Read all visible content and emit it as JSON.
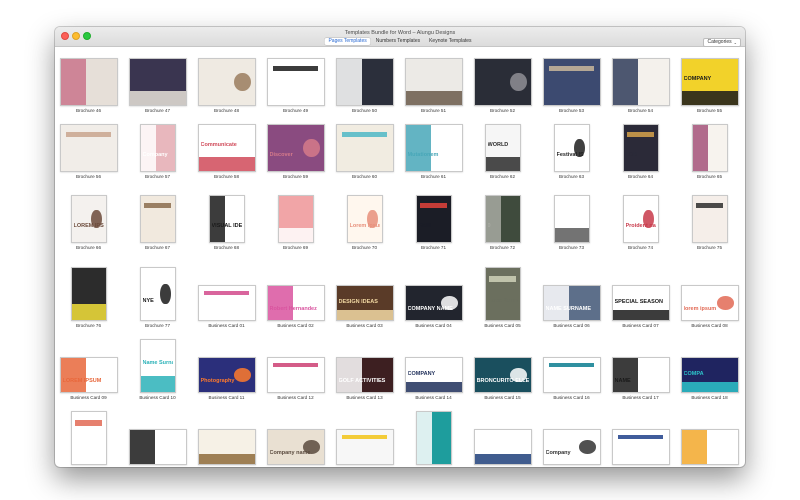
{
  "window": {
    "title": "Templates Bundle for Word – Alungu Designs",
    "tabs": [
      {
        "label": "Pages Templates",
        "active": true
      },
      {
        "label": "Numbers Templates",
        "active": false
      },
      {
        "label": "Keynote Templates",
        "active": false
      }
    ],
    "categories_label": "Categories"
  },
  "rows": [
    [
      {
        "label": "Brochure 46",
        "color": "#e6dfd8",
        "accent": "#c9758c",
        "text": ""
      },
      {
        "label": "Brochure 47",
        "color": "#3a3550",
        "accent": "#e8e2d8",
        "text": ""
      },
      {
        "label": "Brochure 48",
        "color": "#efeae2",
        "accent": "#9a7c5e",
        "text": ""
      },
      {
        "label": "Brochure 49",
        "color": "#ffffff",
        "accent": "#1a1a1a",
        "text": "LOR IPSU DO"
      },
      {
        "label": "Brochure 50",
        "color": "#2b2f3b",
        "accent": "#ffffff",
        "text": ""
      },
      {
        "label": "Brochure 51",
        "color": "#eceae6",
        "accent": "#6b5b4a",
        "text": ""
      },
      {
        "label": "Brochure 52",
        "color": "#2a2d37",
        "accent": "#8f8f95",
        "text": ""
      },
      {
        "label": "Brochure 53",
        "color": "#3c4a70",
        "accent": "#c9b79b",
        "text": ""
      },
      {
        "label": "Brochure 54",
        "color": "#f4f1ec",
        "accent": "#2f3c5a",
        "text": ""
      },
      {
        "label": "Brochure 55",
        "color": "#f2d22a",
        "accent": "#1a1a1a",
        "text": "COMPANY"
      }
    ],
    [
      {
        "label": "Brochure 56",
        "color": "#f1ede8",
        "accent": "#c9a58e",
        "text": ""
      },
      {
        "label": "Brochure 57",
        "color": "#e8b7bd",
        "accent": "#ffffff",
        "text": "Company"
      },
      {
        "label": "Brochure 58",
        "color": "#ffffff",
        "accent": "#d04a59",
        "text": "Communicate"
      },
      {
        "label": "Brochure 59",
        "color": "#8a4b80",
        "accent": "#d57a8a",
        "text": "Discover"
      },
      {
        "label": "Brochure 60",
        "color": "#f1ece1",
        "accent": "#4fb8c6",
        "text": ""
      },
      {
        "label": "Brochure 61",
        "color": "#ffffff",
        "accent": "#48a7b8",
        "text": "Mutationem"
      },
      {
        "label": "Brochure 62",
        "color": "#f6f6f6",
        "accent": "#2c2c2c",
        "text": "WORLD"
      },
      {
        "label": "Brochure 63",
        "color": "#ffffff",
        "accent": "#1f1f1f",
        "text": "Festival IS"
      },
      {
        "label": "Brochure 64",
        "color": "#2b2a38",
        "accent": "#d6a24b",
        "text": "LORI"
      },
      {
        "label": "Brochure 65",
        "color": "#f7f3ee",
        "accent": "#a4527a",
        "text": ""
      }
    ],
    [
      {
        "label": "Brochure 66",
        "color": "#f4f1ee",
        "accent": "#6b4a3a",
        "text": "LOREM IPSUM"
      },
      {
        "label": "Brochure 67",
        "color": "#f1e9de",
        "accent": "#8b6c4e",
        "text": ""
      },
      {
        "label": "Brochure 68",
        "color": "#ffffff",
        "accent": "#1a1a1a",
        "text": "VISUAL IDENTITY"
      },
      {
        "label": "Brochure 69",
        "color": "#f1a5a7",
        "accent": "#ffffff",
        "text": ""
      },
      {
        "label": "Brochure 70",
        "color": "#fff7ee",
        "accent": "#e78f7a",
        "text": "Lorem Ipsum"
      },
      {
        "label": "Brochure 71",
        "color": "#1b1d26",
        "accent": "#e2423b",
        "text": "FAIR"
      },
      {
        "label": "Brochure 72",
        "color": "#3f4b3d",
        "accent": "#a8aaa2",
        "text": "0"
      },
      {
        "label": "Brochure 73",
        "color": "#ffffff",
        "accent": "#5b5b5b",
        "text": ""
      },
      {
        "label": "Brochure 74",
        "color": "#ffffff",
        "accent": "#c8394a",
        "text": "Proident nam"
      },
      {
        "label": "Brochure 75",
        "color": "#f5eee9",
        "accent": "#2d2d2d",
        "text": "01"
      }
    ],
    [
      {
        "label": "Brochure 76",
        "color": "#2c2c2c",
        "accent": "#f3e03a",
        "text": ""
      },
      {
        "label": "Brochure 77",
        "color": "#ffffff",
        "accent": "#1a1a1a",
        "text": "NYE"
      },
      {
        "label": "Business Card 01",
        "color": "#ffffff",
        "accent": "#d24a8c",
        "text": "Name Last Name"
      },
      {
        "label": "Business Card 02",
        "color": "#ffffff",
        "accent": "#d9539f",
        "text": "Robert Hernandez"
      },
      {
        "label": "Business Card 03",
        "color": "#5a3b28",
        "accent": "#f2d9a3",
        "text": "DESIGN IDEAS"
      },
      {
        "label": "Business Card 04",
        "color": "#22252e",
        "accent": "#ffffff",
        "text": "COMPANY NAME"
      },
      {
        "label": "Business Card 05",
        "color": "#6b6f5e",
        "accent": "#cfd2b8",
        "text": "Name Surname"
      },
      {
        "label": "Business Card 06",
        "color": "#5d6f8a",
        "accent": "#ffffff",
        "text": "NAME SURNAME"
      },
      {
        "label": "Business Card 07",
        "color": "#ffffff",
        "accent": "#1a1a1a",
        "text": "SPECIAL SEASON"
      },
      {
        "label": "Business Card 08",
        "color": "#ffffff",
        "accent": "#e26a55",
        "text": "lorem ipsum"
      }
    ],
    [
      {
        "label": "Business Card 09",
        "color": "#ffffff",
        "accent": "#e8673b",
        "text": "LOREM IPSUM"
      },
      {
        "label": "Business Card 10",
        "color": "#ffffff",
        "accent": "#2cb2b8",
        "text": "Name Surname"
      },
      {
        "label": "Business Card 11",
        "color": "#2b2f7b",
        "accent": "#ff7a2c",
        "text": "Photography"
      },
      {
        "label": "Business Card 12",
        "color": "#ffffff",
        "accent": "#cc3f73",
        "text": "LOREM IPSUM"
      },
      {
        "label": "Business Card 13",
        "color": "#3d1f21",
        "accent": "#ffffff",
        "text": "GOLF ACTIVITIES"
      },
      {
        "label": "Business Card 14",
        "color": "#ffffff",
        "accent": "#1f2f5a",
        "text": "COMPANY"
      },
      {
        "label": "Business Card 15",
        "color": "#1a4f5e",
        "accent": "#ffffff",
        "text": "BRONCURITO ELLE"
      },
      {
        "label": "Business Card 16",
        "color": "#ffffff",
        "accent": "#0a7c8f",
        "text": "name"
      },
      {
        "label": "Business Card 17",
        "color": "#ffffff",
        "accent": "#1a1a1a",
        "text": "NAME"
      },
      {
        "label": "Business Card 18",
        "color": "#1f2460",
        "accent": "#2dc3c9",
        "text": "COMPA"
      }
    ],
    [
      {
        "label": "",
        "color": "#ffffff",
        "accent": "#e26a55",
        "text": "Co"
      },
      {
        "label": "",
        "color": "#ffffff",
        "accent": "#1a1a1a",
        "text": ""
      },
      {
        "label": "",
        "color": "#f6f1e6",
        "accent": "#8e6b3a",
        "text": ""
      },
      {
        "label": "",
        "color": "#e9e0d2",
        "accent": "#5a4a3e",
        "text": "Company name"
      },
      {
        "label": "",
        "color": "#f7f7f7",
        "accent": "#f2c417",
        "text": "company"
      },
      {
        "label": "",
        "color": "#1e9d9d",
        "accent": "#ffffff",
        "text": ""
      },
      {
        "label": "",
        "color": "#ffffff",
        "accent": "#1f3f7a",
        "text": ""
      },
      {
        "label": "",
        "color": "#ffffff",
        "accent": "#333333",
        "text": "Company"
      },
      {
        "label": "",
        "color": "#ffffff",
        "accent": "#1f3f8a",
        "text": "COMPANY"
      },
      {
        "label": "",
        "color": "#ffffff",
        "accent": "#f2a82c",
        "text": ""
      }
    ]
  ]
}
